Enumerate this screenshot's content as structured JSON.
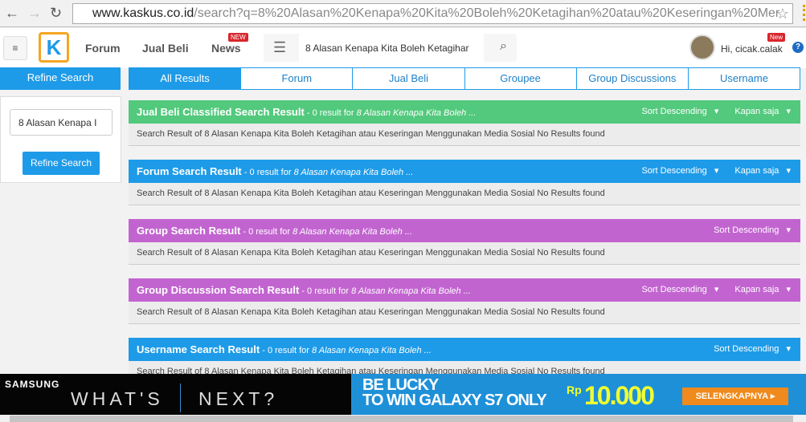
{
  "browser": {
    "url_host": "www.kaskus.co.id",
    "url_path": "/search?q=8%20Alasan%20Kenapa%20Kita%20Boleh%20Ketagihan%20atau%20Keseringan%20Mer"
  },
  "header": {
    "nav": [
      {
        "label": "Forum"
      },
      {
        "label": "Jual Beli"
      },
      {
        "label": "News",
        "badge": "NEW"
      }
    ],
    "search_value": "8 Alasan Kenapa Kita Boleh Ketagihar",
    "greeting": "Hi, cicak.calak",
    "new_badge": "New",
    "help": "?",
    "logo": "K"
  },
  "tabs": {
    "refine": "Refine Search",
    "items": [
      "All Results",
      "Forum",
      "Jual Beli",
      "Groupee",
      "Group Discussions",
      "Username"
    ],
    "active": "All Results"
  },
  "sidebar": {
    "input_value": "8 Alasan Kenapa I",
    "button": "Refine Search"
  },
  "colors": {
    "green": "#52c97c",
    "blue": "#1e9be8",
    "purple": "#c264d0"
  },
  "sections": [
    {
      "title": "Jual Beli Classified Search Result",
      "sub": " - 0 result for ",
      "query": "8 Alasan Kenapa Kita Boleh ...",
      "sort": "Sort Descending",
      "time": "Kapan saja",
      "color": "#52c97c",
      "body": "Search Result of 8 Alasan Kenapa Kita Boleh Ketagihan atau Keseringan Menggunakan Media Sosial No Results found"
    },
    {
      "title": "Forum Search Result",
      "sub": " - 0 result for ",
      "query": "8 Alasan Kenapa Kita Boleh ...",
      "sort": "Sort Descending",
      "time": "Kapan saja",
      "color": "#1e9be8",
      "body": "Search Result of 8 Alasan Kenapa Kita Boleh Ketagihan atau Keseringan Menggunakan Media Sosial No Results found"
    },
    {
      "title": "Group Search Result",
      "sub": " - 0 result for ",
      "query": "8 Alasan Kenapa Kita Boleh ...",
      "sort": "Sort Descending",
      "time": null,
      "color": "#c264d0",
      "body": "Search Result of 8 Alasan Kenapa Kita Boleh Ketagihan atau Keseringan Menggunakan Media Sosial No Results found"
    },
    {
      "title": "Group Discussion Search Result",
      "sub": " - 0 result for ",
      "query": "8 Alasan Kenapa Kita Boleh ...",
      "sort": "Sort Descending",
      "time": "Kapan saja",
      "color": "#c264d0",
      "body": "Search Result of 8 Alasan Kenapa Kita Boleh Ketagihan atau Keseringan Menggunakan Media Sosial No Results found"
    },
    {
      "title": "Username Search Result",
      "sub": " - 0 result for ",
      "query": "8 Alasan Kenapa Kita Boleh ...",
      "sort": "Sort Descending",
      "time": null,
      "color": "#1e9be8",
      "body": "Search Result of 8 Alasan Kenapa Kita Boleh Ketagihan atau Keseringan Menggunakan Media Sosial No Results found"
    }
  ],
  "banner": {
    "brand": "SAMSUNG",
    "tagline_a": "WHAT'S",
    "tagline_b": "NEXT?",
    "line1": "BE LUCKY",
    "line2": "TO WIN GALAXY S7 ONLY",
    "currency": "Rp",
    "price": "10.000",
    "cta": "SELENGKAPNYA ▸"
  }
}
